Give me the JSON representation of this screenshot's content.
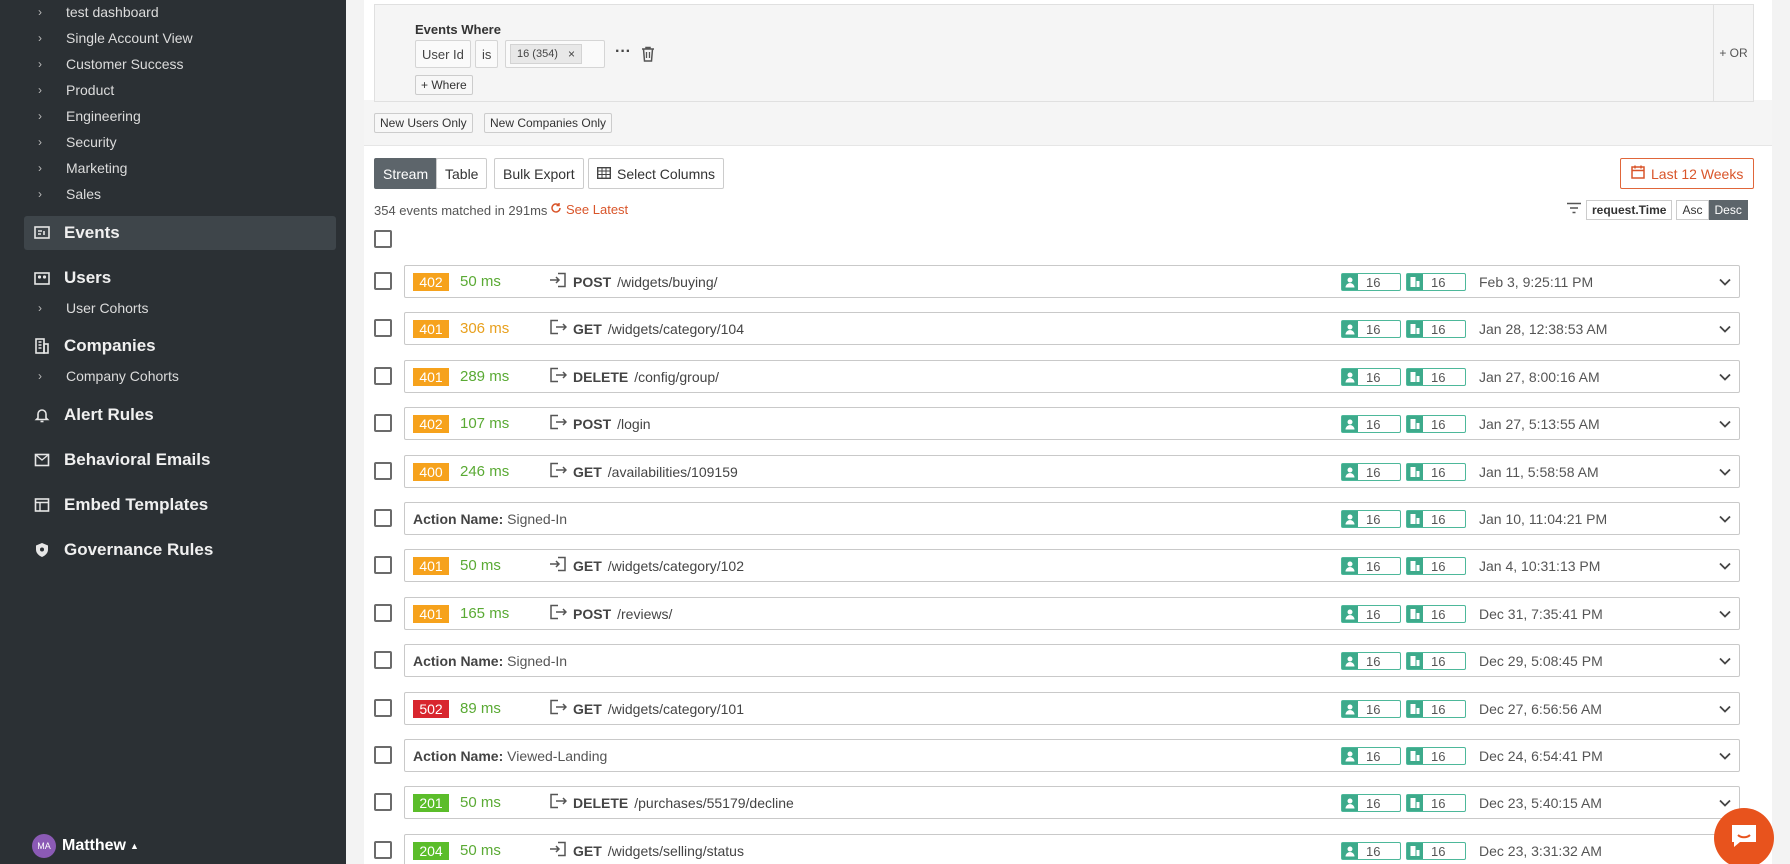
{
  "sidebar": {
    "dashboard_children": [
      "test dashboard",
      "Single Account View",
      "Customer Success",
      "Product",
      "Engineering",
      "Security",
      "Marketing",
      "Sales"
    ],
    "events_label": "Events",
    "users_label": "Users",
    "user_cohorts_label": "User Cohorts",
    "companies_label": "Companies",
    "company_cohorts_label": "Company Cohorts",
    "alert_rules_label": "Alert Rules",
    "behavioral_emails_label": "Behavioral Emails",
    "embed_templates_label": "Embed Templates",
    "governance_rules_label": "Governance Rules",
    "user_name": "Matthew",
    "user_initials": "MA"
  },
  "filters": {
    "title": "Events Where",
    "field": "User Id",
    "operator": "is",
    "value_tag": "16 (354)",
    "more": "···",
    "add_where": "+ Where",
    "add_or": "+ OR",
    "new_users_only": "New Users Only",
    "new_companies_only": "New Companies Only"
  },
  "toolbar": {
    "stream": "Stream",
    "table": "Table",
    "bulk_export": "Bulk Export",
    "select_columns": "Select Columns",
    "date_range": "Last 12 Weeks"
  },
  "summary": {
    "matched": "354 events matched in 291ms",
    "see_latest": "See Latest",
    "sort_field": "request.Time",
    "asc": "Asc",
    "desc": "Desc"
  },
  "colors": {
    "accent": "#e0663a",
    "sidebar_bg": "#2b3034",
    "status_4xx": "#f6a21c",
    "status_5xx": "#d8262e",
    "status_2xx": "#5bbd2a",
    "latency": "#5aaa34",
    "badge": "#3daa8b"
  },
  "events": [
    {
      "kind": "api",
      "status": "402",
      "status_color": "orange",
      "ms": "50 ms",
      "ms_warn": false,
      "direction": "in",
      "method": "POST",
      "path": "/widgets/buying/",
      "user_id": "16",
      "company_id": "16",
      "time": "Feb 3, 9:25:11 PM"
    },
    {
      "kind": "api",
      "status": "401",
      "status_color": "orange",
      "ms": "306 ms",
      "ms_warn": true,
      "direction": "out",
      "method": "GET",
      "path": "/widgets/category/104",
      "user_id": "16",
      "company_id": "16",
      "time": "Jan 28, 12:38:53 AM"
    },
    {
      "kind": "api",
      "status": "401",
      "status_color": "orange",
      "ms": "289 ms",
      "ms_warn": false,
      "direction": "out",
      "method": "DELETE",
      "path": "/config/group/",
      "user_id": "16",
      "company_id": "16",
      "time": "Jan 27, 8:00:16 AM"
    },
    {
      "kind": "api",
      "status": "402",
      "status_color": "orange",
      "ms": "107 ms",
      "ms_warn": false,
      "direction": "out",
      "method": "POST",
      "path": "/login",
      "user_id": "16",
      "company_id": "16",
      "time": "Jan 27, 5:13:55 AM"
    },
    {
      "kind": "api",
      "status": "400",
      "status_color": "orange",
      "ms": "246 ms",
      "ms_warn": false,
      "direction": "out",
      "method": "GET",
      "path": "/availabilities/109159",
      "user_id": "16",
      "company_id": "16",
      "time": "Jan 11, 5:58:58 AM"
    },
    {
      "kind": "action",
      "action_label": "Action Name:",
      "action_name": "Signed-In",
      "user_id": "16",
      "company_id": "16",
      "time": "Jan 10, 11:04:21 PM"
    },
    {
      "kind": "api",
      "status": "401",
      "status_color": "orange",
      "ms": "50 ms",
      "ms_warn": false,
      "direction": "in",
      "method": "GET",
      "path": "/widgets/category/102",
      "user_id": "16",
      "company_id": "16",
      "time": "Jan 4, 10:31:13 PM"
    },
    {
      "kind": "api",
      "status": "401",
      "status_color": "orange",
      "ms": "165 ms",
      "ms_warn": false,
      "direction": "out",
      "method": "POST",
      "path": "/reviews/",
      "user_id": "16",
      "company_id": "16",
      "time": "Dec 31, 7:35:41 PM"
    },
    {
      "kind": "action",
      "action_label": "Action Name:",
      "action_name": "Signed-In",
      "user_id": "16",
      "company_id": "16",
      "time": "Dec 29, 5:08:45 PM"
    },
    {
      "kind": "api",
      "status": "502",
      "status_color": "red",
      "ms": "89 ms",
      "ms_warn": false,
      "direction": "out",
      "method": "GET",
      "path": "/widgets/category/101",
      "user_id": "16",
      "company_id": "16",
      "time": "Dec 27, 6:56:56 AM"
    },
    {
      "kind": "action",
      "action_label": "Action Name:",
      "action_name": "Viewed-Landing",
      "user_id": "16",
      "company_id": "16",
      "time": "Dec 24, 6:54:41 PM"
    },
    {
      "kind": "api",
      "status": "201",
      "status_color": "green",
      "ms": "50 ms",
      "ms_warn": false,
      "direction": "out",
      "method": "DELETE",
      "path": "/purchases/55179/decline",
      "user_id": "16",
      "company_id": "16",
      "time": "Dec 23, 5:40:15 AM"
    },
    {
      "kind": "api",
      "status": "204",
      "status_color": "green",
      "ms": "50 ms",
      "ms_warn": false,
      "direction": "in",
      "method": "GET",
      "path": "/widgets/selling/status",
      "user_id": "16",
      "company_id": "16",
      "time": "Dec 23, 3:31:32 AM"
    }
  ]
}
